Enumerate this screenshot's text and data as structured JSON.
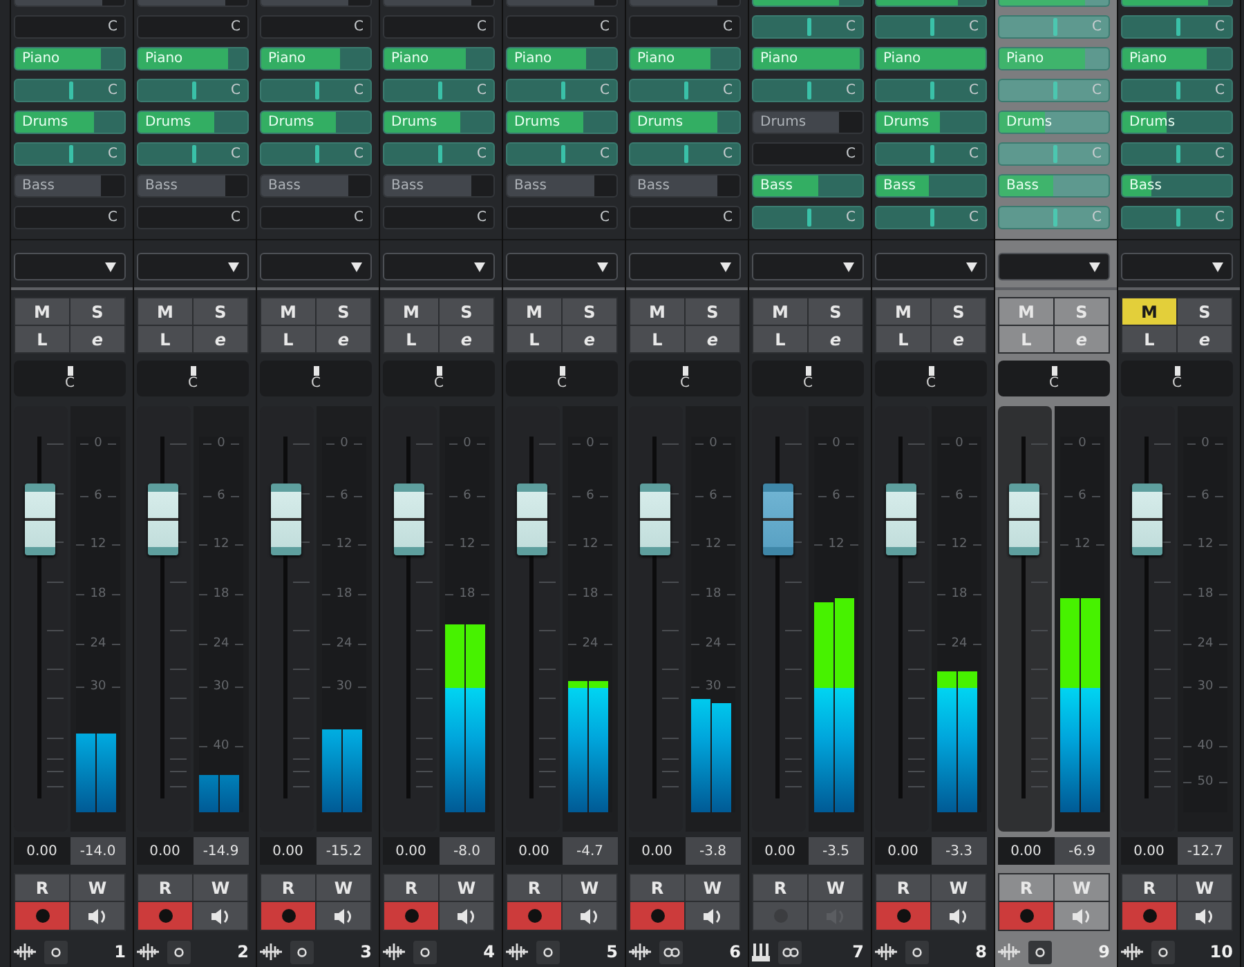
{
  "channels": [
    {
      "number": "1",
      "selected": false,
      "kind": "audio",
      "stereo": false,
      "sends": [
        {
          "on": false,
          "level": 0.8,
          "pan": "C"
        },
        {
          "name": "Piano",
          "on": true,
          "level": 0.78,
          "pan": "C"
        },
        {
          "name": "Drums",
          "on": true,
          "level": 0.72,
          "pan": "C"
        },
        {
          "name": "Bass",
          "on": false,
          "level": 0.78,
          "pan": "C"
        }
      ],
      "buttons": [
        {
          "label": "M",
          "kind": "mute",
          "on": false
        },
        {
          "label": "S",
          "kind": "solo",
          "on": false
        },
        {
          "label": "L",
          "kind": "listen",
          "on": false
        },
        {
          "label": "e",
          "kind": "edit",
          "on": false
        }
      ],
      "pan": "C",
      "fader": {
        "level": 0.77,
        "active": false
      },
      "scale": [
        "0",
        "6",
        "12",
        "18",
        "24",
        "30"
      ],
      "meters": [
        {
          "level": 0.21
        },
        {
          "level": 0.21
        }
      ],
      "volume": "0.00",
      "peak": "-14.0",
      "read": {
        "label": "R",
        "on": false
      },
      "write": {
        "label": "W",
        "on": false
      },
      "record": {
        "enabled": true
      },
      "monitor": {
        "enabled": true
      }
    },
    {
      "number": "2",
      "selected": false,
      "kind": "audio",
      "stereo": false,
      "sends": [
        {
          "on": false,
          "level": 0.8,
          "pan": "C"
        },
        {
          "name": "Piano",
          "on": true,
          "level": 0.82,
          "pan": "C"
        },
        {
          "name": "Drums",
          "on": true,
          "level": 0.7,
          "pan": "C"
        },
        {
          "name": "Bass",
          "on": false,
          "level": 0.8,
          "pan": "C"
        }
      ],
      "buttons": [
        {
          "label": "M",
          "kind": "mute",
          "on": false
        },
        {
          "label": "S",
          "kind": "solo",
          "on": false
        },
        {
          "label": "L",
          "kind": "listen",
          "on": false
        },
        {
          "label": "e",
          "kind": "edit",
          "on": false
        }
      ],
      "pan": "C",
      "fader": {
        "level": 0.77,
        "active": false
      },
      "scale": [
        "0",
        "6",
        "12",
        "18",
        "24",
        "30",
        "40"
      ],
      "meters": [
        {
          "level": 0.1
        },
        {
          "level": 0.1
        }
      ],
      "volume": "0.00",
      "peak": "-14.9",
      "read": {
        "label": "R",
        "on": false
      },
      "write": {
        "label": "W",
        "on": false
      },
      "record": {
        "enabled": true
      },
      "monitor": {
        "enabled": true
      }
    },
    {
      "number": "3",
      "selected": false,
      "kind": "audio",
      "stereo": false,
      "sends": [
        {
          "on": false,
          "level": 0.8,
          "pan": "C"
        },
        {
          "name": "Piano",
          "on": true,
          "level": 0.72,
          "pan": "C"
        },
        {
          "name": "Drums",
          "on": true,
          "level": 0.68,
          "pan": "C"
        },
        {
          "name": "Bass",
          "on": false,
          "level": 0.8,
          "pan": "C"
        }
      ],
      "buttons": [
        {
          "label": "M",
          "kind": "mute",
          "on": false
        },
        {
          "label": "S",
          "kind": "solo",
          "on": false
        },
        {
          "label": "L",
          "kind": "listen",
          "on": false
        },
        {
          "label": "e",
          "kind": "edit",
          "on": false
        }
      ],
      "pan": "C",
      "fader": {
        "level": 0.77,
        "active": false
      },
      "scale": [
        "0",
        "6",
        "12",
        "18",
        "24",
        "30"
      ],
      "meters": [
        {
          "level": 0.22
        },
        {
          "level": 0.22
        }
      ],
      "volume": "0.00",
      "peak": "-15.2",
      "read": {
        "label": "R",
        "on": false
      },
      "write": {
        "label": "W",
        "on": false
      },
      "record": {
        "enabled": true
      },
      "monitor": {
        "enabled": true
      }
    },
    {
      "number": "4",
      "selected": false,
      "kind": "audio",
      "stereo": false,
      "sends": [
        {
          "on": false,
          "level": 0.8,
          "pan": "C"
        },
        {
          "name": "Piano",
          "on": true,
          "level": 0.75,
          "pan": "C"
        },
        {
          "name": "Drums",
          "on": true,
          "level": 0.7,
          "pan": "C"
        },
        {
          "name": "Bass",
          "on": false,
          "level": 0.8,
          "pan": "C"
        }
      ],
      "buttons": [
        {
          "label": "M",
          "kind": "mute",
          "on": false
        },
        {
          "label": "S",
          "kind": "solo",
          "on": false
        },
        {
          "label": "L",
          "kind": "listen",
          "on": false
        },
        {
          "label": "e",
          "kind": "edit",
          "on": false
        }
      ],
      "pan": "C",
      "fader": {
        "level": 0.77,
        "active": false
      },
      "scale": [
        "0",
        "6",
        "12",
        "18"
      ],
      "meters": [
        {
          "level": 0.5
        },
        {
          "level": 0.5
        }
      ],
      "volume": "0.00",
      "peak": "-8.0",
      "read": {
        "label": "R",
        "on": false
      },
      "write": {
        "label": "W",
        "on": false
      },
      "record": {
        "enabled": true
      },
      "monitor": {
        "enabled": true
      }
    },
    {
      "number": "5",
      "selected": false,
      "kind": "audio",
      "stereo": false,
      "sends": [
        {
          "on": false,
          "level": 0.8,
          "pan": "C"
        },
        {
          "name": "Piano",
          "on": true,
          "level": 0.72,
          "pan": "C"
        },
        {
          "name": "Drums",
          "on": true,
          "level": 0.7,
          "pan": "C"
        },
        {
          "name": "Bass",
          "on": false,
          "level": 0.8,
          "pan": "C"
        }
      ],
      "buttons": [
        {
          "label": "M",
          "kind": "mute",
          "on": false
        },
        {
          "label": "S",
          "kind": "solo",
          "on": false
        },
        {
          "label": "L",
          "kind": "listen",
          "on": false
        },
        {
          "label": "e",
          "kind": "edit",
          "on": false
        }
      ],
      "pan": "C",
      "fader": {
        "level": 0.77,
        "active": false
      },
      "scale": [
        "0",
        "6",
        "12",
        "18",
        "24"
      ],
      "meters": [
        {
          "level": 0.35
        },
        {
          "level": 0.35
        }
      ],
      "volume": "0.00",
      "peak": "-4.7",
      "read": {
        "label": "R",
        "on": false
      },
      "write": {
        "label": "W",
        "on": false
      },
      "record": {
        "enabled": true
      },
      "monitor": {
        "enabled": true
      }
    },
    {
      "number": "6",
      "selected": false,
      "kind": "audio",
      "stereo": true,
      "sends": [
        {
          "on": false,
          "level": 0.8,
          "pan": "C"
        },
        {
          "name": "Piano",
          "on": true,
          "level": 0.73,
          "pan": "C"
        },
        {
          "name": "Drums",
          "on": true,
          "level": 0.8,
          "pan": "C"
        },
        {
          "name": "Bass",
          "on": false,
          "level": 0.8,
          "pan": "C"
        }
      ],
      "buttons": [
        {
          "label": "M",
          "kind": "mute",
          "on": false
        },
        {
          "label": "S",
          "kind": "solo",
          "on": false
        },
        {
          "label": "L",
          "kind": "listen",
          "on": false
        },
        {
          "label": "e",
          "kind": "edit",
          "on": false
        }
      ],
      "pan": "C",
      "fader": {
        "level": 0.77,
        "active": false
      },
      "scale": [
        "0",
        "6",
        "12",
        "18",
        "24",
        "30"
      ],
      "meters": [
        {
          "level": 0.3
        },
        {
          "level": 0.29
        }
      ],
      "volume": "0.00",
      "peak": "-3.8",
      "read": {
        "label": "R",
        "on": false
      },
      "write": {
        "label": "W",
        "on": false
      },
      "record": {
        "enabled": true
      },
      "monitor": {
        "enabled": true
      }
    },
    {
      "number": "7",
      "selected": false,
      "kind": "instrument",
      "stereo": true,
      "sends": [
        {
          "on": true,
          "level": 0.78,
          "pan": "C"
        },
        {
          "name": "Piano",
          "on": true,
          "level": 0.97,
          "pan": "C"
        },
        {
          "name": "Drums",
          "on": false,
          "level": 0.78,
          "pan": "C"
        },
        {
          "name": "Bass",
          "on": true,
          "level": 0.6,
          "pan": "C"
        }
      ],
      "buttons": [
        {
          "label": "M",
          "kind": "mute",
          "on": false
        },
        {
          "label": "S",
          "kind": "solo",
          "on": false
        },
        {
          "label": "L",
          "kind": "listen",
          "on": false
        },
        {
          "label": "e",
          "kind": "edit",
          "on": false
        }
      ],
      "pan": "C",
      "fader": {
        "level": 0.77,
        "active": true
      },
      "scale": [
        "0",
        "6",
        "12"
      ],
      "meters": [
        {
          "level": 0.56
        },
        {
          "level": 0.57
        }
      ],
      "volume": "0.00",
      "peak": "-3.5",
      "read": {
        "label": "R",
        "on": false
      },
      "write": {
        "label": "W",
        "on": false
      },
      "record": {
        "enabled": false
      },
      "monitor": {
        "enabled": false
      }
    },
    {
      "number": "8",
      "selected": false,
      "kind": "audio",
      "stereo": false,
      "sends": [
        {
          "on": true,
          "level": 0.75,
          "pan": "C"
        },
        {
          "name": "Piano",
          "on": true,
          "level": 1.0,
          "pan": "C"
        },
        {
          "name": "Drums",
          "on": true,
          "level": 0.58,
          "pan": "C"
        },
        {
          "name": "Bass",
          "on": true,
          "level": 0.48,
          "pan": "C"
        }
      ],
      "buttons": [
        {
          "label": "M",
          "kind": "mute",
          "on": false
        },
        {
          "label": "S",
          "kind": "solo",
          "on": false
        },
        {
          "label": "L",
          "kind": "listen",
          "on": false
        },
        {
          "label": "e",
          "kind": "edit",
          "on": false
        }
      ],
      "pan": "C",
      "fader": {
        "level": 0.77,
        "active": false
      },
      "scale": [
        "0",
        "6",
        "12",
        "18",
        "24"
      ],
      "meters": [
        {
          "level": 0.375
        },
        {
          "level": 0.375
        }
      ],
      "volume": "0.00",
      "peak": "-3.3",
      "read": {
        "label": "R",
        "on": false
      },
      "write": {
        "label": "W",
        "on": false
      },
      "record": {
        "enabled": true
      },
      "monitor": {
        "enabled": true
      }
    },
    {
      "number": "9",
      "selected": true,
      "kind": "audio",
      "stereo": false,
      "sends": [
        {
          "on": true,
          "level": 0.78,
          "pan": "C"
        },
        {
          "name": "Piano",
          "on": true,
          "level": 0.79,
          "pan": "C"
        },
        {
          "name": "Drums",
          "on": true,
          "level": 0.42,
          "pan": "C"
        },
        {
          "name": "Bass",
          "on": true,
          "level": 0.49,
          "pan": "C"
        }
      ],
      "buttons": [
        {
          "label": "M",
          "kind": "mute",
          "on": false
        },
        {
          "label": "S",
          "kind": "solo",
          "on": false
        },
        {
          "label": "L",
          "kind": "listen",
          "on": false
        },
        {
          "label": "e",
          "kind": "edit",
          "on": false
        }
      ],
      "pan": "C",
      "fader": {
        "level": 0.77,
        "active": false
      },
      "scale": [
        "0",
        "6",
        "12"
      ],
      "meters": [
        {
          "level": 0.57
        },
        {
          "level": 0.57
        }
      ],
      "volume": "0.00",
      "peak": "-6.9",
      "read": {
        "label": "R",
        "on": false
      },
      "write": {
        "label": "W",
        "on": false
      },
      "record": {
        "enabled": true
      },
      "monitor": {
        "enabled": true
      }
    },
    {
      "number": "10",
      "selected": false,
      "kind": "audio",
      "stereo": false,
      "sends": [
        {
          "on": true,
          "level": 0.78,
          "pan": "C"
        },
        {
          "name": "Piano",
          "on": true,
          "level": 0.77,
          "pan": "C"
        },
        {
          "name": "Drums",
          "on": true,
          "level": 0.41,
          "pan": "C"
        },
        {
          "name": "Bass",
          "on": true,
          "level": 0.27,
          "pan": "C"
        }
      ],
      "buttons": [
        {
          "label": "M",
          "kind": "mute",
          "on": true
        },
        {
          "label": "S",
          "kind": "solo",
          "on": false
        },
        {
          "label": "L",
          "kind": "listen",
          "on": false
        },
        {
          "label": "e",
          "kind": "edit",
          "on": false
        }
      ],
      "pan": "C",
      "fader": {
        "level": 0.77,
        "active": false
      },
      "scale": [
        "0",
        "6",
        "12",
        "18",
        "24",
        "30",
        "40",
        "50"
      ],
      "volume": "0.00",
      "peak": "-12.7",
      "read": {
        "label": "R",
        "on": false
      },
      "write": {
        "label": "W",
        "on": false
      },
      "record": {
        "enabled": true
      },
      "monitor": {
        "enabled": true
      }
    }
  ]
}
